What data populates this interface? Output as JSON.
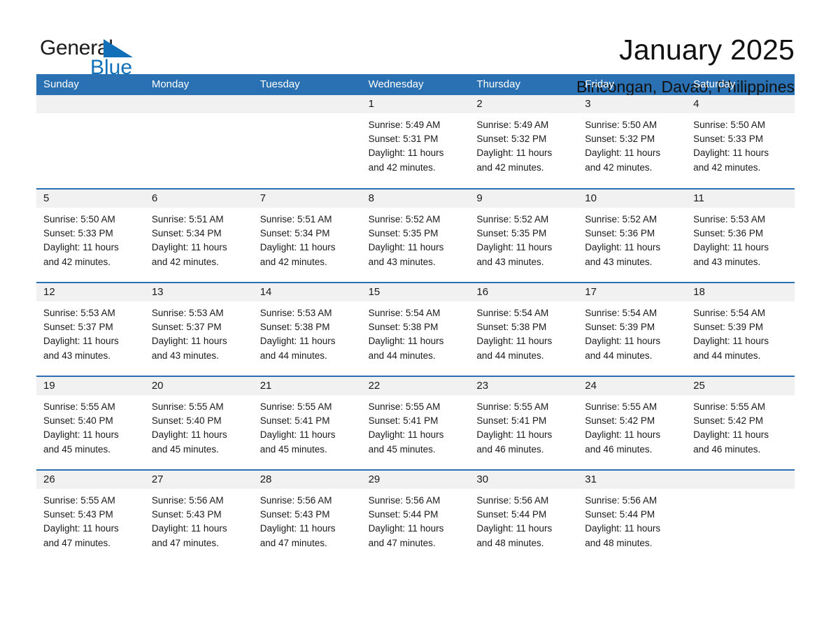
{
  "brand": {
    "name_part1": "General",
    "name_part2": "Blue",
    "triangle_color": "#1270b8",
    "logo_icon": "general-blue-logo"
  },
  "header": {
    "title": "January 2025",
    "subtitle": "Bincongan, Davao, Philippines"
  },
  "colors": {
    "header_blue": "#2a71b3",
    "row_divider_blue": "#2a71b3",
    "daynum_bg": "#f1f1f1",
    "text": "#1a1a1a",
    "brand_blue": "#1270b8"
  },
  "weekdays": [
    "Sunday",
    "Monday",
    "Tuesday",
    "Wednesday",
    "Thursday",
    "Friday",
    "Saturday"
  ],
  "weeks": [
    [
      {
        "day": "",
        "sunrise": "",
        "sunset": "",
        "daylight": "",
        "daylight2": ""
      },
      {
        "day": "",
        "sunrise": "",
        "sunset": "",
        "daylight": "",
        "daylight2": ""
      },
      {
        "day": "",
        "sunrise": "",
        "sunset": "",
        "daylight": "",
        "daylight2": ""
      },
      {
        "day": "1",
        "sunrise": "Sunrise: 5:49 AM",
        "sunset": "Sunset: 5:31 PM",
        "daylight": "Daylight: 11 hours",
        "daylight2": "and 42 minutes."
      },
      {
        "day": "2",
        "sunrise": "Sunrise: 5:49 AM",
        "sunset": "Sunset: 5:32 PM",
        "daylight": "Daylight: 11 hours",
        "daylight2": "and 42 minutes."
      },
      {
        "day": "3",
        "sunrise": "Sunrise: 5:50 AM",
        "sunset": "Sunset: 5:32 PM",
        "daylight": "Daylight: 11 hours",
        "daylight2": "and 42 minutes."
      },
      {
        "day": "4",
        "sunrise": "Sunrise: 5:50 AM",
        "sunset": "Sunset: 5:33 PM",
        "daylight": "Daylight: 11 hours",
        "daylight2": "and 42 minutes."
      }
    ],
    [
      {
        "day": "5",
        "sunrise": "Sunrise: 5:50 AM",
        "sunset": "Sunset: 5:33 PM",
        "daylight": "Daylight: 11 hours",
        "daylight2": "and 42 minutes."
      },
      {
        "day": "6",
        "sunrise": "Sunrise: 5:51 AM",
        "sunset": "Sunset: 5:34 PM",
        "daylight": "Daylight: 11 hours",
        "daylight2": "and 42 minutes."
      },
      {
        "day": "7",
        "sunrise": "Sunrise: 5:51 AM",
        "sunset": "Sunset: 5:34 PM",
        "daylight": "Daylight: 11 hours",
        "daylight2": "and 42 minutes."
      },
      {
        "day": "8",
        "sunrise": "Sunrise: 5:52 AM",
        "sunset": "Sunset: 5:35 PM",
        "daylight": "Daylight: 11 hours",
        "daylight2": "and 43 minutes."
      },
      {
        "day": "9",
        "sunrise": "Sunrise: 5:52 AM",
        "sunset": "Sunset: 5:35 PM",
        "daylight": "Daylight: 11 hours",
        "daylight2": "and 43 minutes."
      },
      {
        "day": "10",
        "sunrise": "Sunrise: 5:52 AM",
        "sunset": "Sunset: 5:36 PM",
        "daylight": "Daylight: 11 hours",
        "daylight2": "and 43 minutes."
      },
      {
        "day": "11",
        "sunrise": "Sunrise: 5:53 AM",
        "sunset": "Sunset: 5:36 PM",
        "daylight": "Daylight: 11 hours",
        "daylight2": "and 43 minutes."
      }
    ],
    [
      {
        "day": "12",
        "sunrise": "Sunrise: 5:53 AM",
        "sunset": "Sunset: 5:37 PM",
        "daylight": "Daylight: 11 hours",
        "daylight2": "and 43 minutes."
      },
      {
        "day": "13",
        "sunrise": "Sunrise: 5:53 AM",
        "sunset": "Sunset: 5:37 PM",
        "daylight": "Daylight: 11 hours",
        "daylight2": "and 43 minutes."
      },
      {
        "day": "14",
        "sunrise": "Sunrise: 5:53 AM",
        "sunset": "Sunset: 5:38 PM",
        "daylight": "Daylight: 11 hours",
        "daylight2": "and 44 minutes."
      },
      {
        "day": "15",
        "sunrise": "Sunrise: 5:54 AM",
        "sunset": "Sunset: 5:38 PM",
        "daylight": "Daylight: 11 hours",
        "daylight2": "and 44 minutes."
      },
      {
        "day": "16",
        "sunrise": "Sunrise: 5:54 AM",
        "sunset": "Sunset: 5:38 PM",
        "daylight": "Daylight: 11 hours",
        "daylight2": "and 44 minutes."
      },
      {
        "day": "17",
        "sunrise": "Sunrise: 5:54 AM",
        "sunset": "Sunset: 5:39 PM",
        "daylight": "Daylight: 11 hours",
        "daylight2": "and 44 minutes."
      },
      {
        "day": "18",
        "sunrise": "Sunrise: 5:54 AM",
        "sunset": "Sunset: 5:39 PM",
        "daylight": "Daylight: 11 hours",
        "daylight2": "and 44 minutes."
      }
    ],
    [
      {
        "day": "19",
        "sunrise": "Sunrise: 5:55 AM",
        "sunset": "Sunset: 5:40 PM",
        "daylight": "Daylight: 11 hours",
        "daylight2": "and 45 minutes."
      },
      {
        "day": "20",
        "sunrise": "Sunrise: 5:55 AM",
        "sunset": "Sunset: 5:40 PM",
        "daylight": "Daylight: 11 hours",
        "daylight2": "and 45 minutes."
      },
      {
        "day": "21",
        "sunrise": "Sunrise: 5:55 AM",
        "sunset": "Sunset: 5:41 PM",
        "daylight": "Daylight: 11 hours",
        "daylight2": "and 45 minutes."
      },
      {
        "day": "22",
        "sunrise": "Sunrise: 5:55 AM",
        "sunset": "Sunset: 5:41 PM",
        "daylight": "Daylight: 11 hours",
        "daylight2": "and 45 minutes."
      },
      {
        "day": "23",
        "sunrise": "Sunrise: 5:55 AM",
        "sunset": "Sunset: 5:41 PM",
        "daylight": "Daylight: 11 hours",
        "daylight2": "and 46 minutes."
      },
      {
        "day": "24",
        "sunrise": "Sunrise: 5:55 AM",
        "sunset": "Sunset: 5:42 PM",
        "daylight": "Daylight: 11 hours",
        "daylight2": "and 46 minutes."
      },
      {
        "day": "25",
        "sunrise": "Sunrise: 5:55 AM",
        "sunset": "Sunset: 5:42 PM",
        "daylight": "Daylight: 11 hours",
        "daylight2": "and 46 minutes."
      }
    ],
    [
      {
        "day": "26",
        "sunrise": "Sunrise: 5:55 AM",
        "sunset": "Sunset: 5:43 PM",
        "daylight": "Daylight: 11 hours",
        "daylight2": "and 47 minutes."
      },
      {
        "day": "27",
        "sunrise": "Sunrise: 5:56 AM",
        "sunset": "Sunset: 5:43 PM",
        "daylight": "Daylight: 11 hours",
        "daylight2": "and 47 minutes."
      },
      {
        "day": "28",
        "sunrise": "Sunrise: 5:56 AM",
        "sunset": "Sunset: 5:43 PM",
        "daylight": "Daylight: 11 hours",
        "daylight2": "and 47 minutes."
      },
      {
        "day": "29",
        "sunrise": "Sunrise: 5:56 AM",
        "sunset": "Sunset: 5:44 PM",
        "daylight": "Daylight: 11 hours",
        "daylight2": "and 47 minutes."
      },
      {
        "day": "30",
        "sunrise": "Sunrise: 5:56 AM",
        "sunset": "Sunset: 5:44 PM",
        "daylight": "Daylight: 11 hours",
        "daylight2": "and 48 minutes."
      },
      {
        "day": "31",
        "sunrise": "Sunrise: 5:56 AM",
        "sunset": "Sunset: 5:44 PM",
        "daylight": "Daylight: 11 hours",
        "daylight2": "and 48 minutes."
      },
      {
        "day": "",
        "sunrise": "",
        "sunset": "",
        "daylight": "",
        "daylight2": ""
      }
    ]
  ]
}
